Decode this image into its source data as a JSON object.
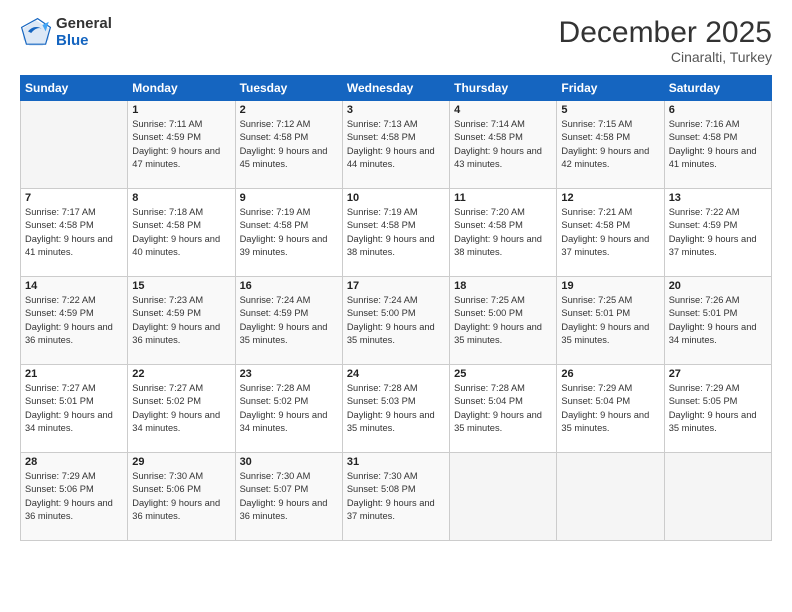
{
  "logo": {
    "general": "General",
    "blue": "Blue"
  },
  "title": "December 2025",
  "location": "Cinaralti, Turkey",
  "days_header": [
    "Sunday",
    "Monday",
    "Tuesday",
    "Wednesday",
    "Thursday",
    "Friday",
    "Saturday"
  ],
  "weeks": [
    [
      {
        "day": "",
        "info": ""
      },
      {
        "day": "1",
        "info": "Sunrise: 7:11 AM\nSunset: 4:59 PM\nDaylight: 9 hours and 47 minutes."
      },
      {
        "day": "2",
        "info": "Sunrise: 7:12 AM\nSunset: 4:58 PM\nDaylight: 9 hours and 45 minutes."
      },
      {
        "day": "3",
        "info": "Sunrise: 7:13 AM\nSunset: 4:58 PM\nDaylight: 9 hours and 44 minutes."
      },
      {
        "day": "4",
        "info": "Sunrise: 7:14 AM\nSunset: 4:58 PM\nDaylight: 9 hours and 43 minutes."
      },
      {
        "day": "5",
        "info": "Sunrise: 7:15 AM\nSunset: 4:58 PM\nDaylight: 9 hours and 42 minutes."
      },
      {
        "day": "6",
        "info": "Sunrise: 7:16 AM\nSunset: 4:58 PM\nDaylight: 9 hours and 41 minutes."
      }
    ],
    [
      {
        "day": "7",
        "info": "Sunrise: 7:17 AM\nSunset: 4:58 PM\nDaylight: 9 hours and 41 minutes."
      },
      {
        "day": "8",
        "info": "Sunrise: 7:18 AM\nSunset: 4:58 PM\nDaylight: 9 hours and 40 minutes."
      },
      {
        "day": "9",
        "info": "Sunrise: 7:19 AM\nSunset: 4:58 PM\nDaylight: 9 hours and 39 minutes."
      },
      {
        "day": "10",
        "info": "Sunrise: 7:19 AM\nSunset: 4:58 PM\nDaylight: 9 hours and 38 minutes."
      },
      {
        "day": "11",
        "info": "Sunrise: 7:20 AM\nSunset: 4:58 PM\nDaylight: 9 hours and 38 minutes."
      },
      {
        "day": "12",
        "info": "Sunrise: 7:21 AM\nSunset: 4:58 PM\nDaylight: 9 hours and 37 minutes."
      },
      {
        "day": "13",
        "info": "Sunrise: 7:22 AM\nSunset: 4:59 PM\nDaylight: 9 hours and 37 minutes."
      }
    ],
    [
      {
        "day": "14",
        "info": "Sunrise: 7:22 AM\nSunset: 4:59 PM\nDaylight: 9 hours and 36 minutes."
      },
      {
        "day": "15",
        "info": "Sunrise: 7:23 AM\nSunset: 4:59 PM\nDaylight: 9 hours and 36 minutes."
      },
      {
        "day": "16",
        "info": "Sunrise: 7:24 AM\nSunset: 4:59 PM\nDaylight: 9 hours and 35 minutes."
      },
      {
        "day": "17",
        "info": "Sunrise: 7:24 AM\nSunset: 5:00 PM\nDaylight: 9 hours and 35 minutes."
      },
      {
        "day": "18",
        "info": "Sunrise: 7:25 AM\nSunset: 5:00 PM\nDaylight: 9 hours and 35 minutes."
      },
      {
        "day": "19",
        "info": "Sunrise: 7:25 AM\nSunset: 5:01 PM\nDaylight: 9 hours and 35 minutes."
      },
      {
        "day": "20",
        "info": "Sunrise: 7:26 AM\nSunset: 5:01 PM\nDaylight: 9 hours and 34 minutes."
      }
    ],
    [
      {
        "day": "21",
        "info": "Sunrise: 7:27 AM\nSunset: 5:01 PM\nDaylight: 9 hours and 34 minutes."
      },
      {
        "day": "22",
        "info": "Sunrise: 7:27 AM\nSunset: 5:02 PM\nDaylight: 9 hours and 34 minutes."
      },
      {
        "day": "23",
        "info": "Sunrise: 7:28 AM\nSunset: 5:02 PM\nDaylight: 9 hours and 34 minutes."
      },
      {
        "day": "24",
        "info": "Sunrise: 7:28 AM\nSunset: 5:03 PM\nDaylight: 9 hours and 35 minutes."
      },
      {
        "day": "25",
        "info": "Sunrise: 7:28 AM\nSunset: 5:04 PM\nDaylight: 9 hours and 35 minutes."
      },
      {
        "day": "26",
        "info": "Sunrise: 7:29 AM\nSunset: 5:04 PM\nDaylight: 9 hours and 35 minutes."
      },
      {
        "day": "27",
        "info": "Sunrise: 7:29 AM\nSunset: 5:05 PM\nDaylight: 9 hours and 35 minutes."
      }
    ],
    [
      {
        "day": "28",
        "info": "Sunrise: 7:29 AM\nSunset: 5:06 PM\nDaylight: 9 hours and 36 minutes."
      },
      {
        "day": "29",
        "info": "Sunrise: 7:30 AM\nSunset: 5:06 PM\nDaylight: 9 hours and 36 minutes."
      },
      {
        "day": "30",
        "info": "Sunrise: 7:30 AM\nSunset: 5:07 PM\nDaylight: 9 hours and 36 minutes."
      },
      {
        "day": "31",
        "info": "Sunrise: 7:30 AM\nSunset: 5:08 PM\nDaylight: 9 hours and 37 minutes."
      },
      {
        "day": "",
        "info": ""
      },
      {
        "day": "",
        "info": ""
      },
      {
        "day": "",
        "info": ""
      }
    ]
  ]
}
